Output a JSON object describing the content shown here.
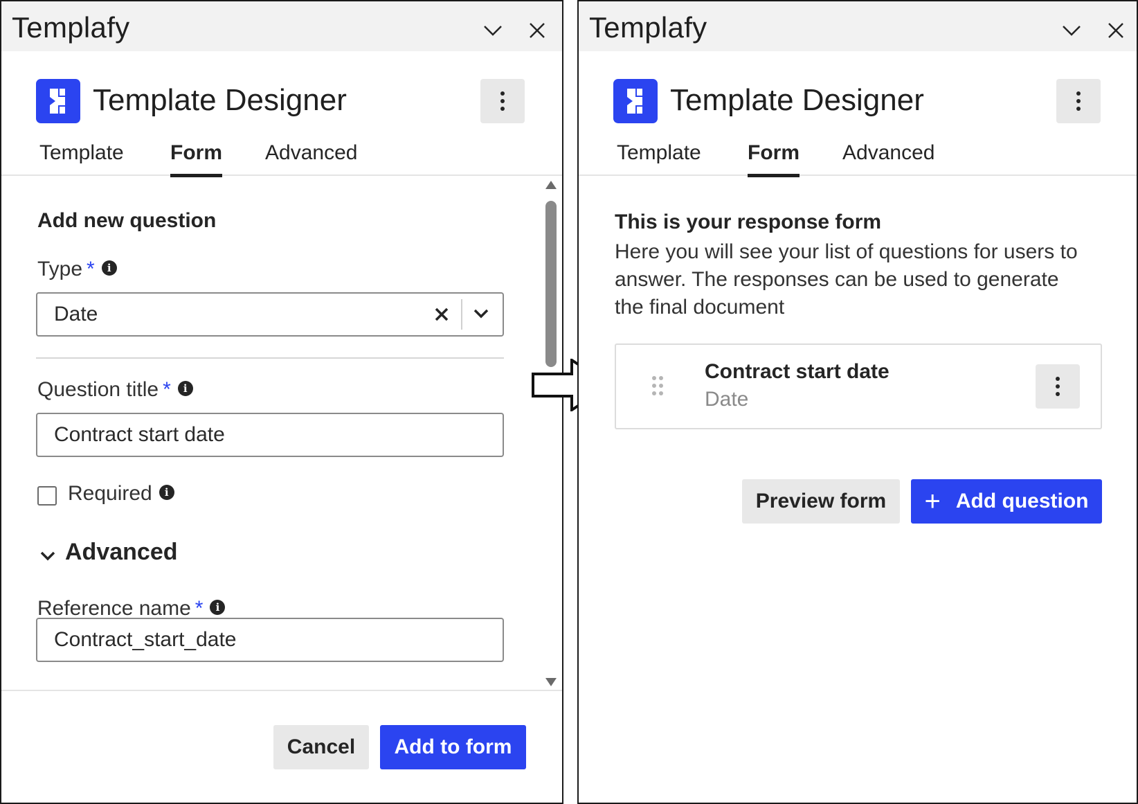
{
  "left": {
    "window_title": "Templafy",
    "app_name": "Template Designer",
    "tabs": [
      {
        "label": "Template"
      },
      {
        "label": "Form"
      },
      {
        "label": "Advanced"
      }
    ],
    "section_title": "Add new question",
    "type_label": "Type",
    "type_required": "*",
    "type_value": "Date",
    "question_title_label": "Question title",
    "question_title_required": "*",
    "question_title_value": "Contract start date",
    "required_label": "Required",
    "required_checked": false,
    "advanced_label": "Advanced",
    "reference_name_label": "Reference name",
    "reference_name_required": "*",
    "reference_name_value": "Contract_start_date",
    "cancel_label": "Cancel",
    "add_to_form_label": "Add to form"
  },
  "right": {
    "window_title": "Templafy",
    "app_name": "Template Designer",
    "tabs": [
      {
        "label": "Template"
      },
      {
        "label": "Form"
      },
      {
        "label": "Advanced"
      }
    ],
    "intro_title": "This is your response form",
    "intro_text": "Here you will see your list of questions for users to answer. The responses can be used to generate the final document",
    "question_card": {
      "title": "Contract start date",
      "type": "Date"
    },
    "preview_form_label": "Preview form",
    "add_question_label": "Add question",
    "add_question_icon": "+"
  },
  "colors": {
    "accent": "#2b44f0",
    "titlebar": "#f2f2f2",
    "secondary_button": "#e8e8e8"
  },
  "icons": [
    "templafy-logo-icon",
    "chevron-down-icon",
    "close-icon",
    "kebab-icon",
    "info-icon",
    "clear-icon",
    "drag-handle-icon",
    "plus-icon",
    "arrow-right-icon"
  ]
}
